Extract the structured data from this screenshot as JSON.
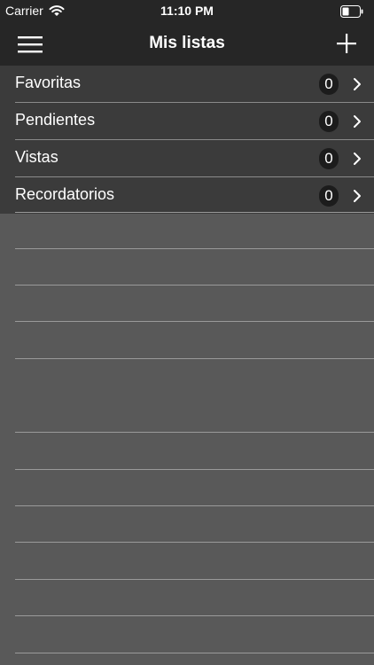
{
  "status_bar": {
    "carrier": "Carrier",
    "time": "11:10 PM",
    "wifi_icon": "wifi-icon",
    "battery_icon": "battery-icon"
  },
  "nav_bar": {
    "title": "Mis listas",
    "menu_icon": "hamburger-menu-icon",
    "add_icon": "plus-icon"
  },
  "lists": [
    {
      "label": "Favoritas",
      "count": "0"
    },
    {
      "label": "Pendientes",
      "count": "0"
    },
    {
      "label": "Vistas",
      "count": "0"
    },
    {
      "label": "Recordatorios",
      "count": "0"
    }
  ],
  "colors": {
    "bar_background": "#262626",
    "list_background": "#3b3b3b",
    "empty_background": "#595959",
    "badge_background": "#1c1c1c",
    "separator": "#8a8a8a"
  }
}
